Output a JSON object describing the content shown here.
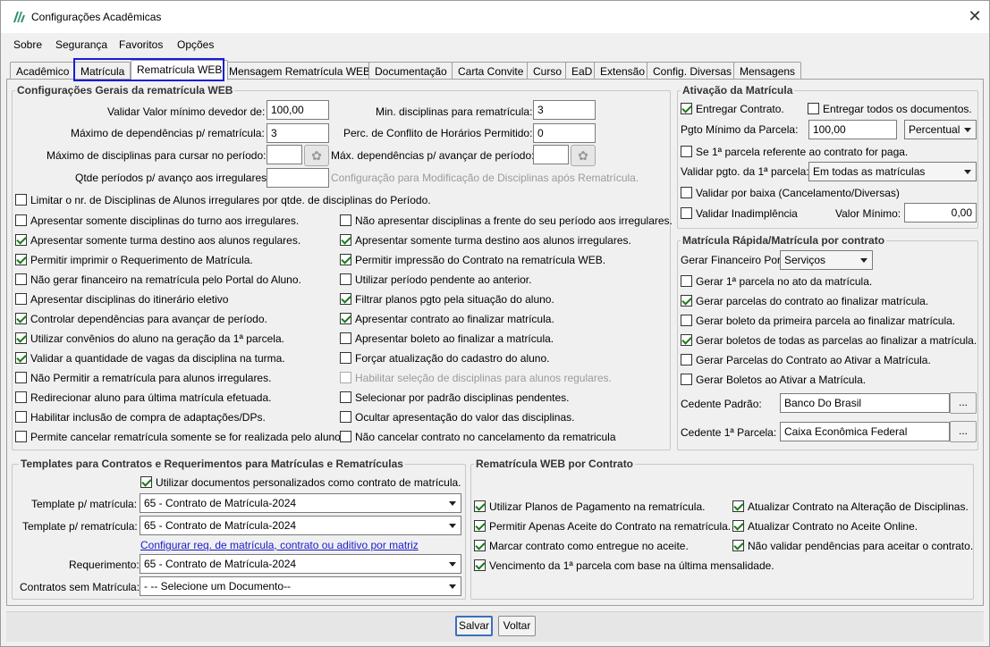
{
  "window": {
    "title": "Configurações Acadêmicas",
    "close_glyph": "✕"
  },
  "menu": [
    "Sobre",
    "Segurança",
    "Favoritos",
    "Opções"
  ],
  "tabs": [
    "Acadêmico",
    "Matrícula",
    "Rematrícula WEB",
    "Mensagem Rematrícula WEB",
    "Documentação",
    "Carta Convite",
    "Curso",
    "EaD",
    "Extensão",
    "Config. Diversas",
    "Mensagens"
  ],
  "active_tab": "Rematrícula WEB",
  "general": {
    "title": "Configurações Gerais da rematrícula WEB",
    "fields": {
      "min_devedor_label": "Validar Valor mínimo devedor de:",
      "min_devedor_value": "100,00",
      "min_disciplinas_label": "Min. disciplinas para rematrícula:",
      "min_disciplinas_value": "3",
      "max_dependencias_label": "Máximo de dependências p/ rematrícula:",
      "max_dependencias_value": "3",
      "perc_conflito_label": "Perc. de Conflito de Horários Permitido:",
      "perc_conflito_value": "0",
      "max_cursar_label": "Máximo de disciplinas para cursar no período:",
      "max_cursar_value": "",
      "max_dep_avancar_label": "Máx. dependências p/ avançar de período:",
      "max_dep_avancar_value": "",
      "qtde_periodos_label": "Qtde períodos p/ avanço aos irregulares:",
      "qtde_periodos_value": "",
      "config_mod_label": "Configuração para Modificação de Disciplinas após Rematrícula."
    },
    "limitar_label": "Limitar o nr. de Disciplinas de Alunos irregulares por qtde. de disciplinas do Período.",
    "limitar_checked": false,
    "left_checks": [
      {
        "label": "Apresentar somente disciplinas do turno aos irregulares.",
        "checked": false
      },
      {
        "label": "Apresentar somente turma destino aos alunos regulares.",
        "checked": true
      },
      {
        "label": "Permitir imprimir o Requerimento de Matrícula.",
        "checked": true
      },
      {
        "label": "Não gerar financeiro na rematrícula pelo Portal do Aluno.",
        "checked": false
      },
      {
        "label": "Apresentar disciplinas do itinerário eletivo",
        "checked": false
      },
      {
        "label": "Controlar dependências para avançar de período.",
        "checked": true
      },
      {
        "label": "Utilizar convênios do aluno na geração da 1ª parcela.",
        "checked": true
      },
      {
        "label": "Validar a quantidade de vagas da disciplina na turma.",
        "checked": true
      },
      {
        "label": "Não Permitir a rematrícula para alunos irregulares.",
        "checked": false
      },
      {
        "label": "Redirecionar aluno para última matrícula efetuada.",
        "checked": false
      },
      {
        "label": "Habilitar inclusão de compra de adaptações/DPs.",
        "checked": false
      },
      {
        "label": "Permite cancelar rematrícula somente se for realizada pelo aluno.",
        "checked": false
      }
    ],
    "right_checks": [
      {
        "label": "Não apresentar disciplinas a frente do seu período aos irregulares.",
        "checked": false,
        "disabled": false
      },
      {
        "label": "Apresentar somente turma destino aos alunos irregulares.",
        "checked": true,
        "disabled": false
      },
      {
        "label": "Permitir impressão do Contrato na rematrícula WEB.",
        "checked": true,
        "disabled": false
      },
      {
        "label": "Utilizar período pendente ao anterior.",
        "checked": false,
        "disabled": false
      },
      {
        "label": "Filtrar planos pgto pela situação do aluno.",
        "checked": true,
        "disabled": false
      },
      {
        "label": "Apresentar contrato ao finalizar matrícula.",
        "checked": true,
        "disabled": false
      },
      {
        "label": "Apresentar boleto ao finalizar a matrícula.",
        "checked": false,
        "disabled": false
      },
      {
        "label": "Forçar atualização do cadastro do aluno.",
        "checked": false,
        "disabled": false
      },
      {
        "label": "Habilitar seleção de disciplinas para alunos regulares.",
        "checked": false,
        "disabled": true
      },
      {
        "label": "Selecionar por padrão disciplinas pendentes.",
        "checked": false,
        "disabled": false
      },
      {
        "label": "Ocultar apresentação do valor das disciplinas.",
        "checked": false,
        "disabled": false
      },
      {
        "label": "Não cancelar contrato no cancelamento da rematricula",
        "checked": false,
        "disabled": false
      }
    ]
  },
  "ativacao": {
    "title": "Ativação da Matrícula",
    "entregar_contrato_label": "Entregar Contrato.",
    "entregar_contrato_checked": true,
    "entregar_docs_label": "Entregar todos os documentos.",
    "entregar_docs_checked": false,
    "pgto_minimo_label": "Pgto Mínimo da Parcela:",
    "pgto_minimo_value": "100,00",
    "pgto_tipo": "Percentual",
    "se_primeira_label": "Se 1ª parcela referente ao contrato for paga.",
    "se_primeira_checked": false,
    "validar_pgto_label": "Validar pgto. da 1ª parcela:",
    "validar_pgto_value": "Em todas as matrículas",
    "validar_baixa_label": "Validar por baixa (Cancelamento/Diversas)",
    "validar_baixa_checked": false,
    "validar_inad_label": "Validar Inadimplência",
    "validar_inad_checked": false,
    "valor_minimo_label": "Valor Mínimo:",
    "valor_minimo_value": "0,00"
  },
  "rapida": {
    "title": "Matrícula Rápida/Matrícula por contrato",
    "gerar_fin_label": "Gerar Financeiro Por:",
    "gerar_fin_value": "Serviços",
    "checks": [
      {
        "label": "Gerar 1ª parcela no ato da matrícula.",
        "checked": false
      },
      {
        "label": "Gerar parcelas do contrato ao finalizar matrícula.",
        "checked": true
      },
      {
        "label": "Gerar boleto da primeira parcela ao finalizar matrícula.",
        "checked": false
      },
      {
        "label": "Gerar boletos de todas as parcelas ao finalizar a matrícula.",
        "checked": true
      },
      {
        "label": "Gerar Parcelas do Contrato ao Ativar a Matrícula.",
        "checked": false
      },
      {
        "label": "Gerar Boletos ao Ativar a Matrícula.",
        "checked": false
      }
    ],
    "cedente_label": "Cedente Padrão:",
    "cedente_value": "Banco Do Brasil",
    "cedente1_label": "Cedente 1ª Parcela:",
    "cedente1_value": "Caixa Econômica Federal",
    "dots": "..."
  },
  "templates": {
    "title": "Templates para Contratos e Requerimentos para Matrículas e Rematrículas",
    "utilizar_label": "Utilizar documentos personalizados como contrato de matrícula.",
    "utilizar_checked": true,
    "tpl_matricula_label": "Template p/ matrícula:",
    "tpl_matricula_value": "65 - Contrato de Matrícula-2024",
    "tpl_rematricula_label": "Template p/ rematrícula:",
    "tpl_rematricula_value": "65 - Contrato de Matrícula-2024",
    "config_link": "Configurar req. de matrícula, contrato ou aditivo por matriz",
    "requerimento_label": "Requerimento:",
    "requerimento_value": "65 - Contrato de Matrícula-2024",
    "sem_matricula_label": "Contratos sem Matrícula:",
    "sem_matricula_value": "- -- Selecione um Documento--"
  },
  "webcontrato": {
    "title": "Rematrícula WEB por Contrato",
    "checks": [
      {
        "label": "Utilizar Planos de Pagamento na rematrícula.",
        "checked": true
      },
      {
        "label": "Atualizar Contrato na Alteração de Disciplinas.",
        "checked": true
      },
      {
        "label": "Permitir Apenas Aceite do Contrato na rematrícula.",
        "checked": true
      },
      {
        "label": "Atualizar Contrato no Aceite Online.",
        "checked": true
      },
      {
        "label": "Marcar contrato como entregue no aceite.",
        "checked": true
      },
      {
        "label": "Não validar pendências para aceitar o contrato.",
        "checked": true
      },
      {
        "label": "Vencimento da 1ª parcela com base na última mensalidade.",
        "checked": true
      }
    ]
  },
  "buttons": {
    "save": "Salvar",
    "back": "Voltar"
  },
  "colors": {
    "check": "#1a7a1a",
    "tab_highlight": "#1a1adc",
    "link": "#1a1ad0"
  }
}
